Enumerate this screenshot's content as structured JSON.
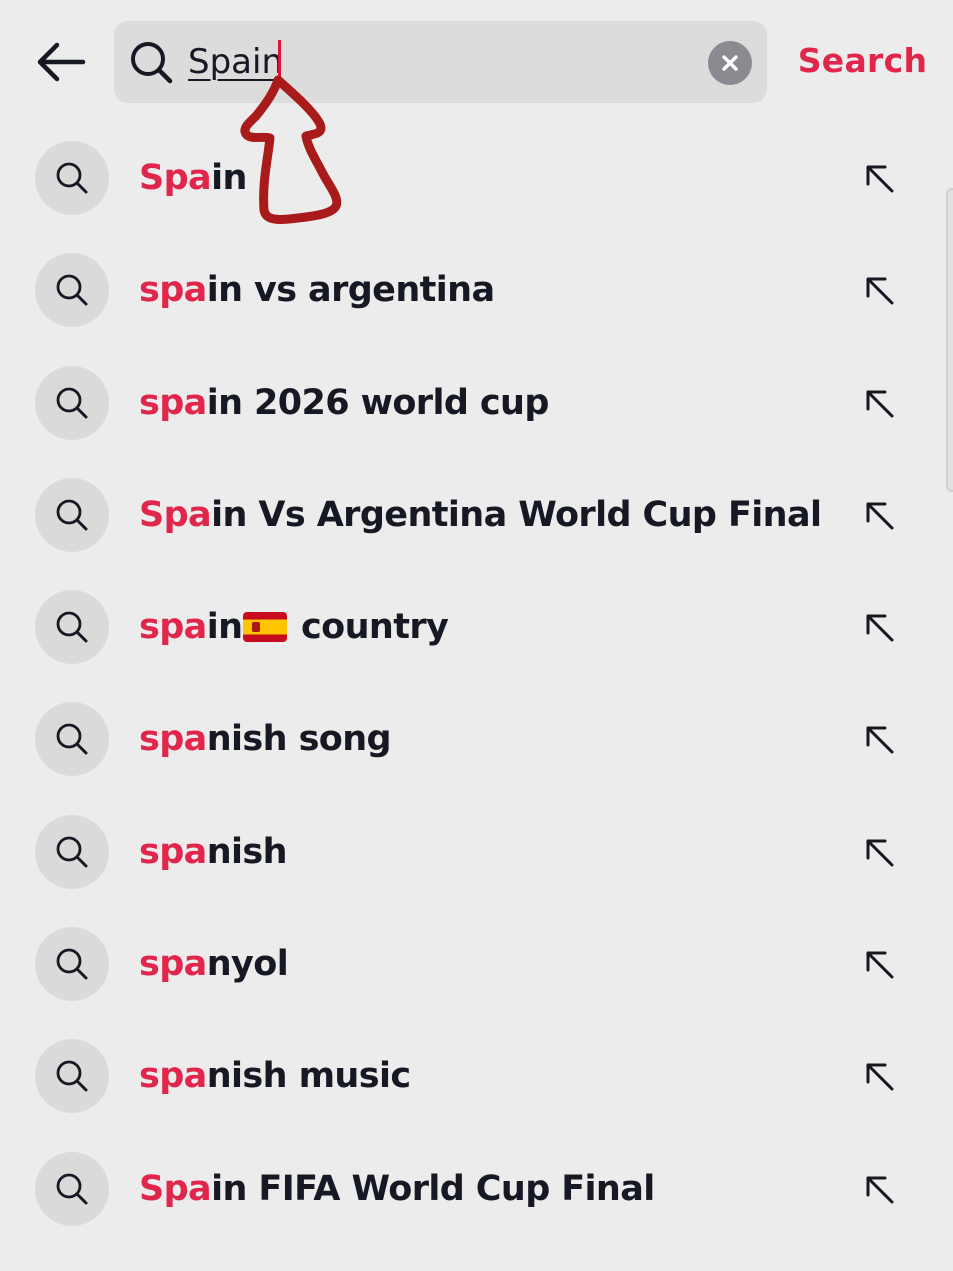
{
  "header": {
    "back_icon": "arrow-left-icon",
    "search_icon": "search-icon",
    "query_value": "Spain",
    "clear_icon": "close-circle-icon",
    "search_button_label": "Search"
  },
  "colors": {
    "accent": "#e0264b",
    "text": "#161823",
    "background": "#ececec",
    "search_box": "#dcdcdc"
  },
  "suggestions": [
    {
      "match": "Spa",
      "rest": "in"
    },
    {
      "match": "spa",
      "rest": "in vs argentina"
    },
    {
      "match": "spa",
      "rest": "in 2026 world cup"
    },
    {
      "match": "Spa",
      "rest": "in Vs Argentina World Cup Final"
    },
    {
      "match": "spa",
      "rest": "in",
      "flag": "spain-flag-emoji",
      "after": " country"
    },
    {
      "match": "spa",
      "rest": "nish song"
    },
    {
      "match": "spa",
      "rest": "nish"
    },
    {
      "match": "spa",
      "rest": "nyol"
    },
    {
      "match": "spa",
      "rest": "nish music"
    },
    {
      "match": "Spa",
      "rest": "in FIFA World Cup Final"
    }
  ],
  "suggestion_fill_icon": "arrow-up-left-icon"
}
